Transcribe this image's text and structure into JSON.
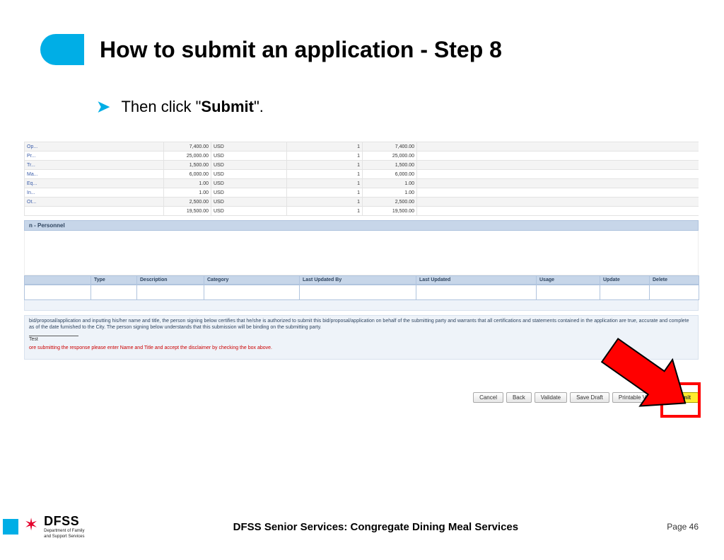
{
  "title": "How to submit an application - Step 8",
  "bullet": {
    "pre": "Then click \"",
    "emph": "Submit",
    "post": "\"."
  },
  "budget_rows": [
    {
      "name": "Op...",
      "amount": "7,400.00",
      "currency": "USD",
      "qty": "1",
      "total": "7,400.00"
    },
    {
      "name": "Pr...",
      "amount": "25,000.00",
      "currency": "USD",
      "qty": "1",
      "total": "25,000.00"
    },
    {
      "name": "Tr...",
      "amount": "1,500.00",
      "currency": "USD",
      "qty": "1",
      "total": "1,500.00"
    },
    {
      "name": "Ma...",
      "amount": "6,000.00",
      "currency": "USD",
      "qty": "1",
      "total": "6,000.00"
    },
    {
      "name": "Eq...",
      "amount": "1.00",
      "currency": "USD",
      "qty": "1",
      "total": "1.00"
    },
    {
      "name": "In...",
      "amount": "1.00",
      "currency": "USD",
      "qty": "1",
      "total": "1.00"
    },
    {
      "name": "Ot...",
      "amount": "2,500.00",
      "currency": "USD",
      "qty": "1",
      "total": "2,500.00"
    },
    {
      "name": "",
      "amount": "19,500.00",
      "currency": "USD",
      "qty": "1",
      "total": "19,500.00"
    }
  ],
  "section_label": "n - Personnel",
  "attach_headers": [
    "",
    "Type",
    "Description",
    "Category",
    "Last Updated By",
    "Last Updated",
    "Usage",
    "Update",
    "Delete"
  ],
  "disclaimer": "bid/proposal/application and inputting his/her name and title, the person signing below certifies that he/she is authorized to submit this bid/proposal/application on behalf of the submitting party and warrants that all certifications and statements contained in the application are true, accurate and complete as of the date furnished to the City. The person signing below understands that this submission will be binding on the submitting party.",
  "signature_label": "Test",
  "error_msg": "ore submitting the response please enter Name and Title and accept the disclaimer by checking the box above.",
  "buttons": {
    "cancel": "Cancel",
    "back": "Back",
    "validate": "Validate",
    "save_draft": "Save Draft",
    "printable": "Printable View",
    "submit": "Submit"
  },
  "footer": {
    "org_acronym": "DFSS",
    "org_line1": "Department of Family",
    "org_line2": "and Support Services",
    "center": "DFSS Senior Services: Congregate Dining Meal Services",
    "page": "Page 46"
  }
}
